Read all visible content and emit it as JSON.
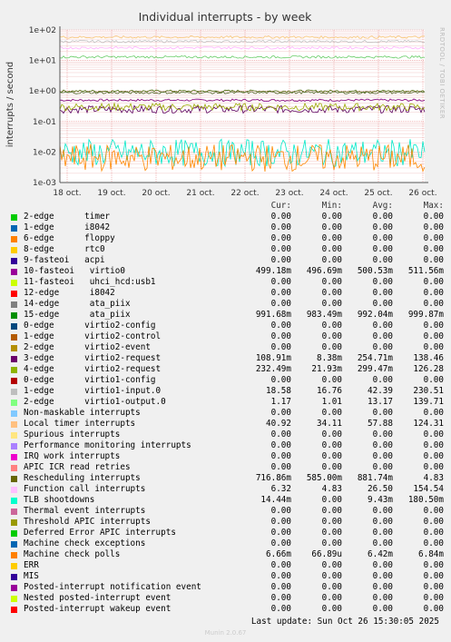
{
  "chart_data": {
    "type": "line",
    "title": "Individual interrupts - by week",
    "ylabel": "interrupts / second",
    "yscale": "log",
    "ylim": [
      0.001,
      100
    ],
    "yticks": [
      "1e+02",
      "1e+01",
      "1e+00",
      "1e-01",
      "1e-02",
      "1e-03"
    ],
    "xticks": [
      "18 oct.",
      "19 oct.",
      "20 oct.",
      "21 oct.",
      "22 oct.",
      "23 oct.",
      "24 oct.",
      "25 oct.",
      "26 oct."
    ],
    "grid": true,
    "side_label": "RRDTOOL / TOBI OETIKER",
    "series": [
      {
        "name": "10-fasteoi virtio0",
        "color": "#800080",
        "level": 0.5
      },
      {
        "name": "15-edge ata_piix",
        "color": "#4a6a0a",
        "level": 0.99
      },
      {
        "name": "3-edge virtio2-request",
        "color": "#5a0060",
        "level": 0.25
      },
      {
        "name": "4-edge virtio2-request",
        "color": "#9aa800",
        "level": 0.3
      },
      {
        "name": "1-edge virtio1-input.0",
        "color": "#c0c0c0",
        "level": 42
      },
      {
        "name": "2-edge virtio1-output.0",
        "color": "#66cc66",
        "level": 13
      },
      {
        "name": "Local timer interrupts",
        "color": "#f8c878",
        "level": 58
      },
      {
        "name": "Rescheduling interrupts",
        "color": "#556b2f",
        "level": 0.88
      },
      {
        "name": "Function call interrupts",
        "color": "#ffb0ff",
        "level": 26
      },
      {
        "name": "TLB shootdowns",
        "color": "#00e8c8",
        "level": 0.0094
      },
      {
        "name": "Machine check polls",
        "color": "#ff8800",
        "level": 0.0064
      }
    ]
  },
  "legend": {
    "headers": {
      "cur": "Cur:",
      "min": "Min:",
      "avg": "Avg:",
      "max": "Max:"
    },
    "rows": [
      {
        "name": "2-edge      timer",
        "color": "#00cc00",
        "cur": "0.00",
        "min": "0.00",
        "avg": "0.00",
        "max": "0.00"
      },
      {
        "name": "1-edge      i8042",
        "color": "#0066b3",
        "cur": "0.00",
        "min": "0.00",
        "avg": "0.00",
        "max": "0.00"
      },
      {
        "name": "6-edge      floppy",
        "color": "#ff8000",
        "cur": "0.00",
        "min": "0.00",
        "avg": "0.00",
        "max": "0.00"
      },
      {
        "name": "8-edge      rtc0",
        "color": "#ffcc00",
        "cur": "0.00",
        "min": "0.00",
        "avg": "0.00",
        "max": "0.00"
      },
      {
        "name": "9-fasteoi   acpi",
        "color": "#330099",
        "cur": "0.00",
        "min": "0.00",
        "avg": "0.00",
        "max": "0.00"
      },
      {
        "name": "10-fasteoi   virtio0",
        "color": "#990099",
        "cur": "499.18m",
        "min": "496.69m",
        "avg": "500.53m",
        "max": "511.56m"
      },
      {
        "name": "11-fasteoi   uhci_hcd:usb1",
        "color": "#ccff00",
        "cur": "0.00",
        "min": "0.00",
        "avg": "0.00",
        "max": "0.00"
      },
      {
        "name": "12-edge      i8042",
        "color": "#ff0000",
        "cur": "0.00",
        "min": "0.00",
        "avg": "0.00",
        "max": "0.00"
      },
      {
        "name": "14-edge      ata_piix",
        "color": "#808080",
        "cur": "0.00",
        "min": "0.00",
        "avg": "0.00",
        "max": "0.00"
      },
      {
        "name": "15-edge      ata_piix",
        "color": "#008f00",
        "cur": "991.68m",
        "min": "983.49m",
        "avg": "992.04m",
        "max": "999.87m"
      },
      {
        "name": "0-edge      virtio2-config",
        "color": "#00487d",
        "cur": "0.00",
        "min": "0.00",
        "avg": "0.00",
        "max": "0.00"
      },
      {
        "name": "1-edge      virtio2-control",
        "color": "#b35a00",
        "cur": "0.00",
        "min": "0.00",
        "avg": "0.00",
        "max": "0.00"
      },
      {
        "name": "2-edge      virtio2-event",
        "color": "#b38f00",
        "cur": "0.00",
        "min": "0.00",
        "avg": "0.00",
        "max": "0.00"
      },
      {
        "name": "3-edge      virtio2-request",
        "color": "#6b006b",
        "cur": "108.91m",
        "min": "8.38m",
        "avg": "254.71m",
        "max": "138.46"
      },
      {
        "name": "4-edge      virtio2-request",
        "color": "#8fb300",
        "cur": "232.49m",
        "min": "21.93m",
        "avg": "299.47m",
        "max": "126.28"
      },
      {
        "name": "0-edge      virtio1-config",
        "color": "#b30000",
        "cur": "0.00",
        "min": "0.00",
        "avg": "0.00",
        "max": "0.00"
      },
      {
        "name": "1-edge      virtio1-input.0",
        "color": "#bebebe",
        "cur": "18.58",
        "min": "16.76",
        "avg": "42.39",
        "max": "230.51"
      },
      {
        "name": "2-edge      virtio1-output.0",
        "color": "#80ff80",
        "cur": "1.17",
        "min": "1.01",
        "avg": "13.17",
        "max": "139.71"
      },
      {
        "name": "Non-maskable interrupts",
        "color": "#80c9ff",
        "cur": "0.00",
        "min": "0.00",
        "avg": "0.00",
        "max": "0.00"
      },
      {
        "name": "Local timer interrupts",
        "color": "#ffc080",
        "cur": "40.92",
        "min": "34.11",
        "avg": "57.88",
        "max": "124.31"
      },
      {
        "name": "Spurious interrupts",
        "color": "#ffe680",
        "cur": "0.00",
        "min": "0.00",
        "avg": "0.00",
        "max": "0.00"
      },
      {
        "name": "Performance monitoring interrupts",
        "color": "#aa80ff",
        "cur": "0.00",
        "min": "0.00",
        "avg": "0.00",
        "max": "0.00"
      },
      {
        "name": "IRQ work interrupts",
        "color": "#ee00cc",
        "cur": "0.00",
        "min": "0.00",
        "avg": "0.00",
        "max": "0.00"
      },
      {
        "name": "APIC ICR read retries",
        "color": "#ff8080",
        "cur": "0.00",
        "min": "0.00",
        "avg": "0.00",
        "max": "0.00"
      },
      {
        "name": "Rescheduling interrupts",
        "color": "#666600",
        "cur": "716.86m",
        "min": "585.00m",
        "avg": "881.74m",
        "max": "4.83"
      },
      {
        "name": "Function call interrupts",
        "color": "#ffbfff",
        "cur": "6.32",
        "min": "4.83",
        "avg": "26.50",
        "max": "154.54"
      },
      {
        "name": "TLB shootdowns",
        "color": "#00ffcc",
        "cur": "14.44m",
        "min": "0.00",
        "avg": "9.43m",
        "max": "180.50m"
      },
      {
        "name": "Thermal event interrupts",
        "color": "#cc6699",
        "cur": "0.00",
        "min": "0.00",
        "avg": "0.00",
        "max": "0.00"
      },
      {
        "name": "Threshold APIC interrupts",
        "color": "#999900",
        "cur": "0.00",
        "min": "0.00",
        "avg": "0.00",
        "max": "0.00"
      },
      {
        "name": "Deferred Error APIC interrupts",
        "color": "#00cc00",
        "cur": "0.00",
        "min": "0.00",
        "avg": "0.00",
        "max": "0.00"
      },
      {
        "name": "Machine check exceptions",
        "color": "#0066b3",
        "cur": "0.00",
        "min": "0.00",
        "avg": "0.00",
        "max": "0.00"
      },
      {
        "name": "Machine check polls",
        "color": "#ff8000",
        "cur": "6.66m",
        "min": "66.89u",
        "avg": "6.42m",
        "max": "6.84m"
      },
      {
        "name": "ERR",
        "color": "#ffcc00",
        "cur": "0.00",
        "min": "0.00",
        "avg": "0.00",
        "max": "0.00"
      },
      {
        "name": "MIS",
        "color": "#330099",
        "cur": "0.00",
        "min": "0.00",
        "avg": "0.00",
        "max": "0.00"
      },
      {
        "name": "Posted-interrupt notification event",
        "color": "#990099",
        "cur": "0.00",
        "min": "0.00",
        "avg": "0.00",
        "max": "0.00"
      },
      {
        "name": "Nested posted-interrupt event",
        "color": "#ccff00",
        "cur": "0.00",
        "min": "0.00",
        "avg": "0.00",
        "max": "0.00"
      },
      {
        "name": "Posted-interrupt wakeup event",
        "color": "#ff0000",
        "cur": "0.00",
        "min": "0.00",
        "avg": "0.00",
        "max": "0.00"
      }
    ]
  },
  "footer": {
    "last_update": "Last update: Sun Oct 26 15:30:05 2025",
    "munin": "Munin 2.0.67"
  }
}
